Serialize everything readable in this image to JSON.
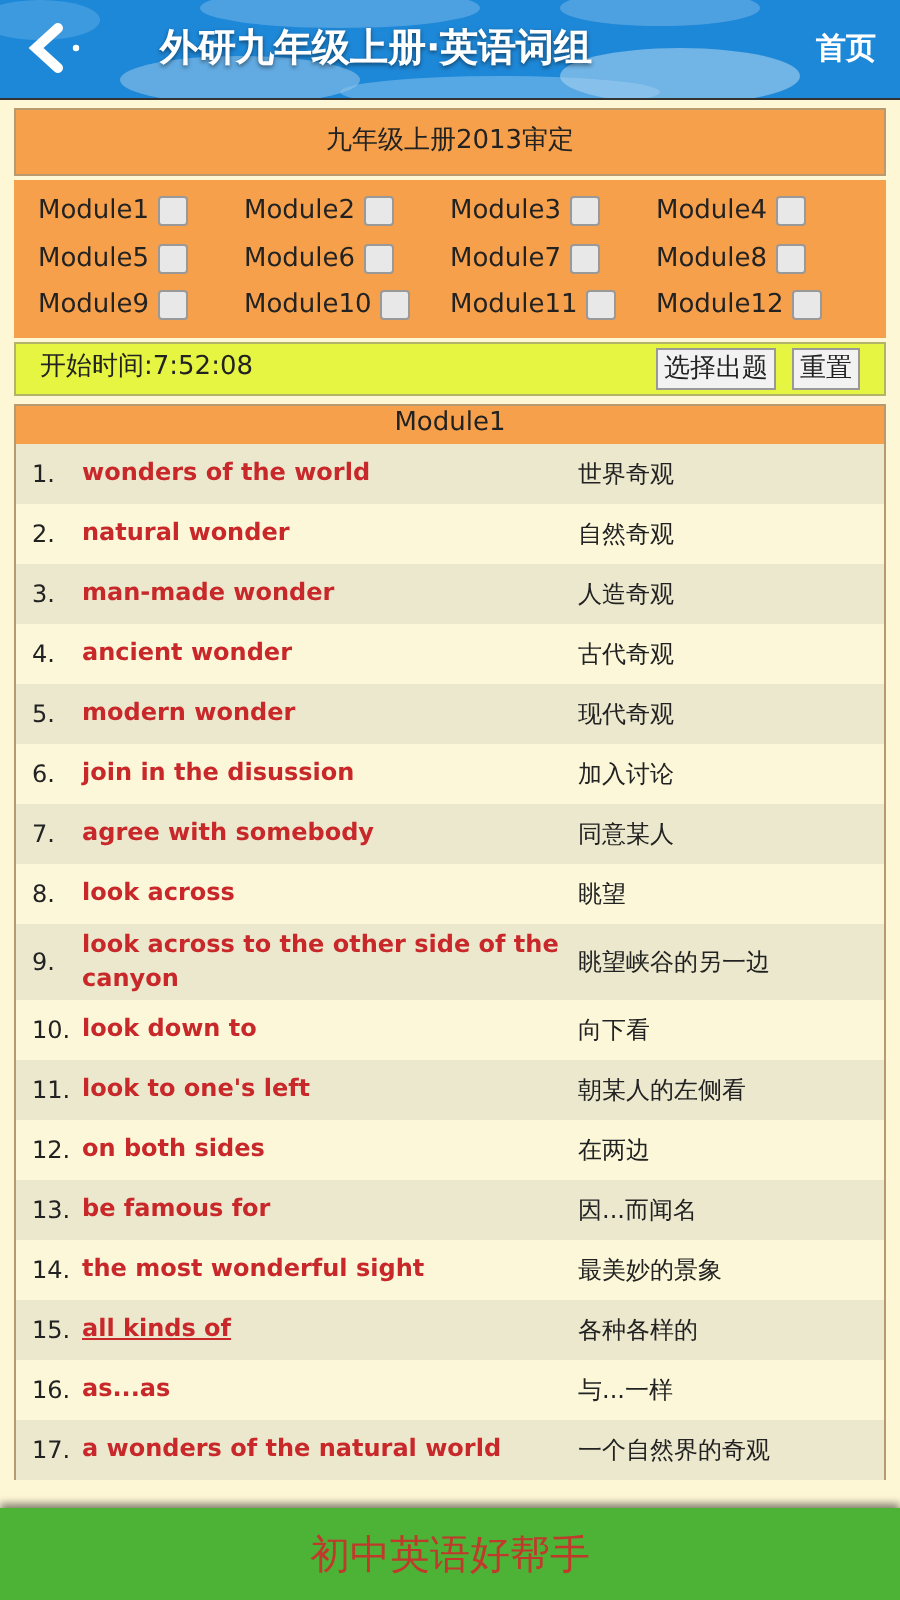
{
  "header": {
    "title": "外研九年级上册·英语词组",
    "home": "首页"
  },
  "book_title": "九年级上册2013审定",
  "modules": [
    {
      "label": "Module1",
      "checked": false
    },
    {
      "label": "Module2",
      "checked": false
    },
    {
      "label": "Module3",
      "checked": false
    },
    {
      "label": "Module4",
      "checked": false
    },
    {
      "label": "Module5",
      "checked": false
    },
    {
      "label": "Module6",
      "checked": false
    },
    {
      "label": "Module7",
      "checked": false
    },
    {
      "label": "Module8",
      "checked": false
    },
    {
      "label": "Module9",
      "checked": false
    },
    {
      "label": "Module10",
      "checked": false
    },
    {
      "label": "Module11",
      "checked": false
    },
    {
      "label": "Module12",
      "checked": false
    }
  ],
  "timer": {
    "text": "开始时间:7:52:08",
    "buttons": [
      "选择出题",
      "重置"
    ]
  },
  "table": {
    "title": "Module1",
    "rows": [
      {
        "num": "1.",
        "phrase": "wonders of the world",
        "meaning": "世界奇观",
        "underlined": false
      },
      {
        "num": "2.",
        "phrase": "natural wonder",
        "meaning": "自然奇观",
        "underlined": false
      },
      {
        "num": "3.",
        "phrase": "man-made wonder",
        "meaning": "人造奇观",
        "underlined": false
      },
      {
        "num": "4.",
        "phrase": "ancient wonder",
        "meaning": "古代奇观",
        "underlined": false
      },
      {
        "num": "5.",
        "phrase": "modern wonder",
        "meaning": "现代奇观",
        "underlined": false
      },
      {
        "num": "6.",
        "phrase": "join in the disussion",
        "meaning": "加入讨论",
        "underlined": false
      },
      {
        "num": "7.",
        "phrase": "agree with somebody",
        "meaning": "同意某人",
        "underlined": false
      },
      {
        "num": "8.",
        "phrase": "look across",
        "meaning": "眺望",
        "underlined": false
      },
      {
        "num": "9.",
        "phrase": "look across to the other side of the canyon",
        "meaning": "眺望峡谷的另一边",
        "underlined": false
      },
      {
        "num": "10.",
        "phrase": "look down to",
        "meaning": "向下看",
        "underlined": false
      },
      {
        "num": "11.",
        "phrase": "look to one's left",
        "meaning": "朝某人的左侧看",
        "underlined": false
      },
      {
        "num": "12.",
        "phrase": "on both sides",
        "meaning": "在两边",
        "underlined": false
      },
      {
        "num": "13.",
        "phrase": "be famous for",
        "meaning": "因...而闻名",
        "underlined": false
      },
      {
        "num": "14.",
        "phrase": "the most wonderful sight",
        "meaning": "最美妙的景象",
        "underlined": false
      },
      {
        "num": "15.",
        "phrase": "all kinds of",
        "meaning": "各种各样的",
        "underlined": true
      },
      {
        "num": "16.",
        "phrase": "as...as",
        "meaning": "与...一样",
        "underlined": false
      },
      {
        "num": "17.",
        "phrase": "a wonders of the natural world",
        "meaning": "一个自然界的奇观",
        "underlined": false
      }
    ]
  },
  "banner": "初中英语好帮手"
}
